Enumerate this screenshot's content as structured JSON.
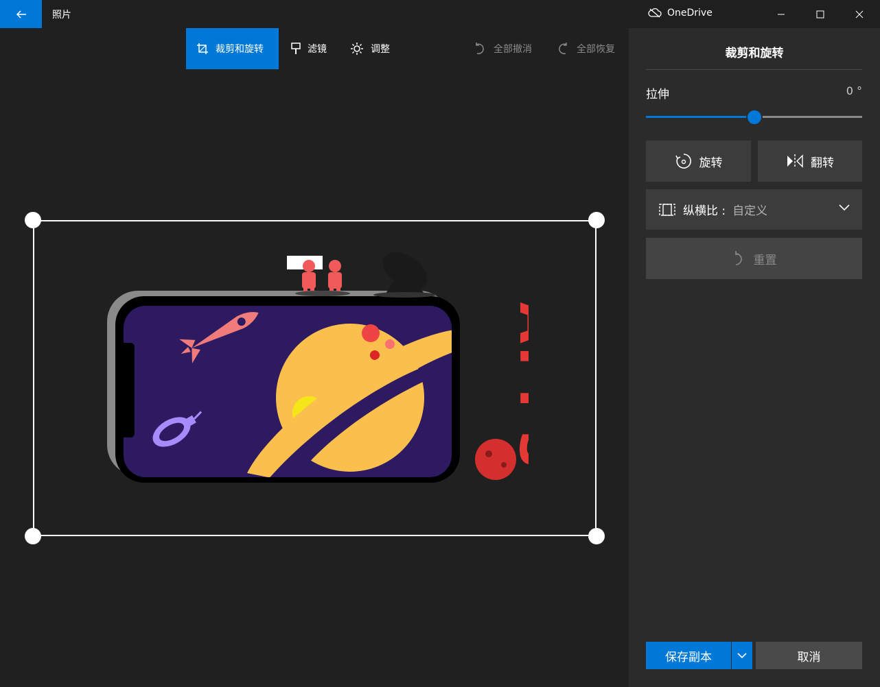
{
  "titlebar": {
    "app_title": "照片",
    "onedrive_label": "OneDrive",
    "icons": [
      "back-arrow-icon",
      "cloud-off-icon",
      "minimize-icon",
      "maximize-icon",
      "close-icon"
    ]
  },
  "toolbar": {
    "crop_rotate": "裁剪和旋转",
    "filters": "滤镜",
    "adjust": "调整",
    "undo_all": "全部撤消",
    "redo_all": "全部恢复"
  },
  "artwork": {
    "logo_text": "APPS"
  },
  "panel": {
    "title": "裁剪和旋转",
    "straighten_label": "拉伸",
    "straighten_value": "0 °",
    "straighten_level": 0.5,
    "rotate_label": "旋转",
    "flip_label": "翻转",
    "aspect_label": "纵横比 :",
    "aspect_value": "自定义",
    "reset_label": "重置",
    "save_copy": "保存副本",
    "cancel": "取消"
  },
  "colors": {
    "accent": "#0078d7",
    "background": "#202020",
    "panel": "#2b2b2b",
    "button": "#3c3c3c"
  }
}
